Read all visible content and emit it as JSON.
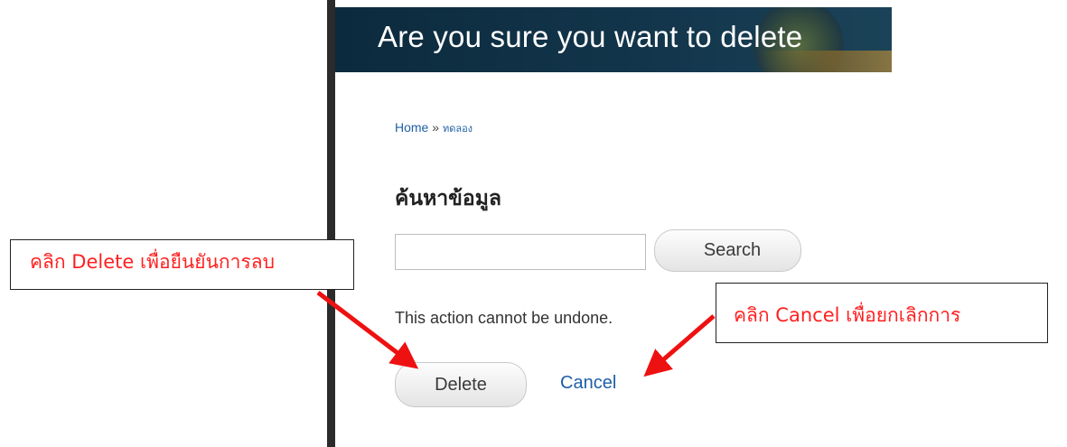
{
  "header": {
    "title": "Are you sure you want to delete"
  },
  "breadcrumb": {
    "home": "Home",
    "separator": "»",
    "current": "ทดลอง"
  },
  "search_block": {
    "title": "ค้นหาข้อมูล",
    "input_value": "",
    "button_label": "Search"
  },
  "confirm": {
    "notice": "This action cannot be undone.",
    "delete_label": "Delete",
    "cancel_label": "Cancel"
  },
  "annotations": {
    "delete_hint": "คลิก Delete เพื่อยืนยันการลบ",
    "cancel_hint": "คลิก Cancel เพื่อยกเลิกการ"
  },
  "colors": {
    "header_bg": "#0c2a3d",
    "link": "#1e5fa6",
    "annotation_text": "#ff2020",
    "arrow": "#ee1111"
  }
}
